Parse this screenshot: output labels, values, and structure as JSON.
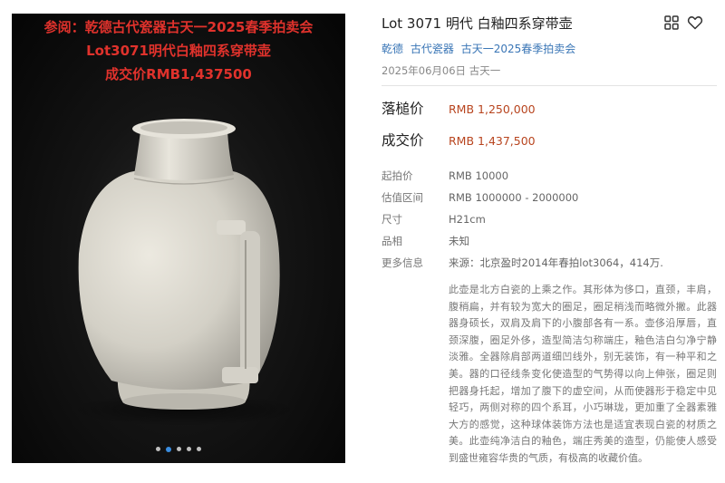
{
  "image": {
    "watermark_line1": "参阅：乾德古代瓷器古天一2025春季拍卖会",
    "watermark_line2": "Lot3071明代白釉四系穿带壶",
    "watermark_line3": "成交价RMB1,437500",
    "carousel": {
      "count": 5,
      "active_index": 1
    }
  },
  "lot": {
    "title": "Lot 3071 明代 白釉四系穿带壶",
    "breadcrumb": [
      "乾德",
      "古代瓷器",
      "古天一2025春季拍卖会"
    ],
    "date": "2025年06月06日 古天一"
  },
  "prices": {
    "hammer_label": "落槌价",
    "hammer_value": "RMB 1,250,000",
    "sold_label": "成交价",
    "sold_value": "RMB 1,437,500"
  },
  "attributes": {
    "start_label": "起拍价",
    "start_value": "RMB 10000",
    "estimate_label": "估值区间",
    "estimate_value": "RMB 1000000 - 2000000",
    "size_label": "尺寸",
    "size_value": "H21cm",
    "condition_label": "品相",
    "condition_value": "未知",
    "more_label": "更多信息",
    "more_value": "来源：北京盈时2014年春拍lot3064，414万."
  },
  "description": "此壶是北方白瓷的上乘之作。其形体为侈口，直颈，丰肩，腹稍扁，并有较为宽大的圈足，圈足稍浅而略微外撇。此器器身硕长，双肩及肩下的小腹部各有一系。壶侈沿厚唇，直颈深腹，圈足外侈，造型简洁匀称端庄，釉色洁白匀净宁静淡雅。全器除肩部两道细凹线外，别无装饰，有一种平和之美。器的口径线条变化使造型的气势得以向上伸张，圈足则把器身托起，增加了腹下的虚空间，从而使器形于稳定中见轻巧，两侧对称的四个系耳，小巧琳珑，更加重了全器素雅大方的感觉，这种球体装饰方法也是适宜表现白瓷的材质之美。此壶纯净洁白的釉色，端庄秀美的造型，仍能使人感受到盛世雍容华贵的气质，有极高的收藏价值。",
  "colors": {
    "accent_price": "#b8451f",
    "link": "#3a76b6",
    "watermark": "#e0322c"
  }
}
